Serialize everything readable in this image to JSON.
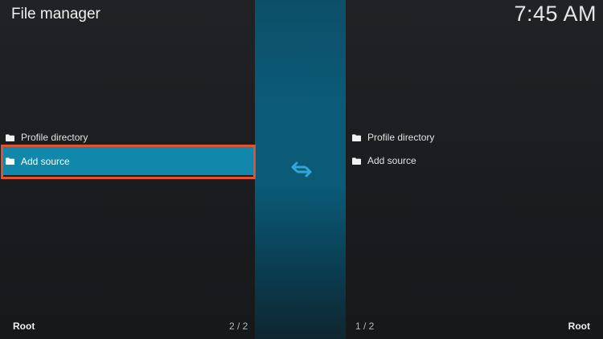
{
  "header": {
    "title": "File manager",
    "clock": "7:45 AM"
  },
  "left_pane": {
    "items": [
      {
        "label": "Profile directory",
        "icon": "folder-icon"
      },
      {
        "label": "Add source",
        "icon": "folder-icon",
        "selected": true
      }
    ],
    "footer_path": "Root",
    "footer_count": "2 / 2"
  },
  "right_pane": {
    "items": [
      {
        "label": "Profile directory",
        "icon": "folder-icon"
      },
      {
        "label": "Add source",
        "icon": "folder-icon"
      }
    ],
    "footer_path": "Root",
    "footer_count": "1 / 2"
  },
  "center": {
    "icon": "swap-arrows-icon"
  },
  "colors": {
    "accent": "#1187ac",
    "highlight_border": "#e2522c",
    "center_strip": "#0b5a77"
  }
}
